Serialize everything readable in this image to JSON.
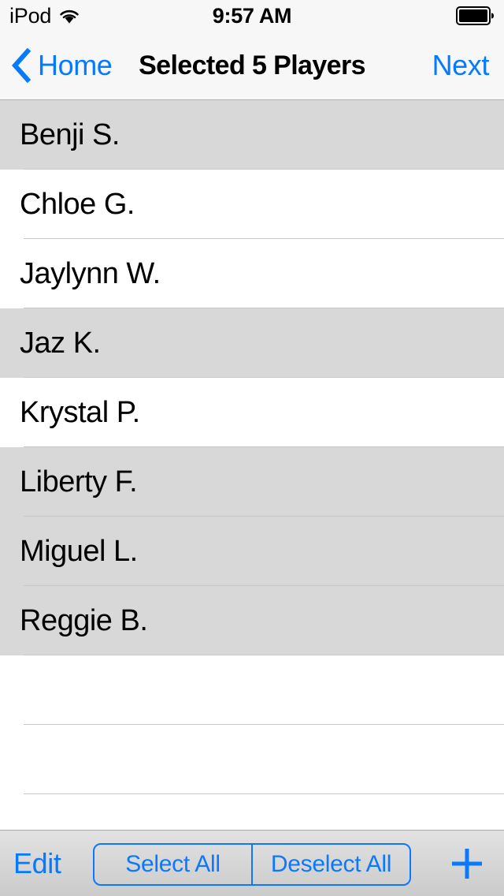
{
  "status_bar": {
    "carrier": "iPod",
    "wifi_icon": "wifi-icon",
    "time": "9:57 AM",
    "battery_icon": "battery-full-icon"
  },
  "nav_bar": {
    "back_icon": "chevron-left-icon",
    "back_label": "Home",
    "title": "Selected 5 Players",
    "next_label": "Next"
  },
  "list": {
    "rows": [
      {
        "label": "Benji S.",
        "selected": true
      },
      {
        "label": "Chloe G.",
        "selected": false
      },
      {
        "label": "Jaylynn W.",
        "selected": false
      },
      {
        "label": "Jaz K.",
        "selected": true
      },
      {
        "label": "Krystal P.",
        "selected": false
      },
      {
        "label": "Liberty F.",
        "selected": true
      },
      {
        "label": "Miguel L.",
        "selected": true
      },
      {
        "label": "Reggie B.",
        "selected": true
      },
      {
        "label": "",
        "selected": false
      },
      {
        "label": "",
        "selected": false
      },
      {
        "label": "",
        "selected": false
      }
    ]
  },
  "toolbar": {
    "edit_label": "Edit",
    "segments": [
      {
        "label": "Select All"
      },
      {
        "label": "Deselect All"
      }
    ],
    "add_icon": "plus-icon"
  },
  "colors": {
    "tint_blue": "#047aff",
    "selected_row_gray": "#d8d8d8",
    "bar_background": "#f7f7f7",
    "separator": "#c8c8c8"
  }
}
